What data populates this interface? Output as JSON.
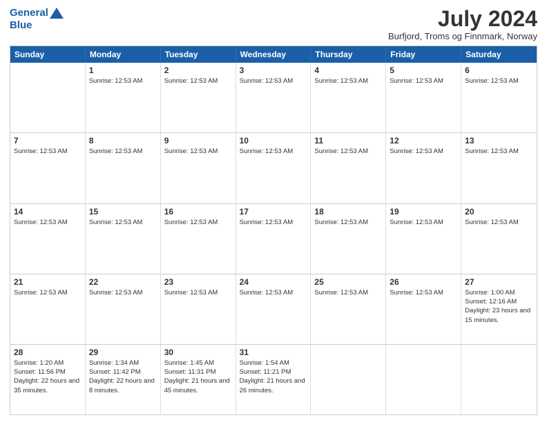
{
  "logo": {
    "line1": "General",
    "line2": "Blue"
  },
  "title": "July 2024",
  "subtitle": "Burfjord, Troms og Finnmark, Norway",
  "header_days": [
    "Sunday",
    "Monday",
    "Tuesday",
    "Wednesday",
    "Thursday",
    "Friday",
    "Saturday"
  ],
  "weeks": [
    [
      {
        "day": "",
        "info": ""
      },
      {
        "day": "1",
        "info": "Sunrise: 12:53 AM"
      },
      {
        "day": "2",
        "info": "Sunrise: 12:53 AM"
      },
      {
        "day": "3",
        "info": "Sunrise: 12:53 AM"
      },
      {
        "day": "4",
        "info": "Sunrise: 12:53 AM"
      },
      {
        "day": "5",
        "info": "Sunrise: 12:53 AM"
      },
      {
        "day": "6",
        "info": "Sunrise: 12:53 AM"
      }
    ],
    [
      {
        "day": "7",
        "info": "Sunrise: 12:53 AM"
      },
      {
        "day": "8",
        "info": "Sunrise: 12:53 AM"
      },
      {
        "day": "9",
        "info": "Sunrise: 12:53 AM"
      },
      {
        "day": "10",
        "info": "Sunrise: 12:53 AM"
      },
      {
        "day": "11",
        "info": "Sunrise: 12:53 AM"
      },
      {
        "day": "12",
        "info": "Sunrise: 12:53 AM"
      },
      {
        "day": "13",
        "info": "Sunrise: 12:53 AM"
      }
    ],
    [
      {
        "day": "14",
        "info": "Sunrise: 12:53 AM"
      },
      {
        "day": "15",
        "info": "Sunrise: 12:53 AM"
      },
      {
        "day": "16",
        "info": "Sunrise: 12:53 AM"
      },
      {
        "day": "17",
        "info": "Sunrise: 12:53 AM"
      },
      {
        "day": "18",
        "info": "Sunrise: 12:53 AM"
      },
      {
        "day": "19",
        "info": "Sunrise: 12:53 AM"
      },
      {
        "day": "20",
        "info": "Sunrise: 12:53 AM"
      }
    ],
    [
      {
        "day": "21",
        "info": "Sunrise: 12:53 AM"
      },
      {
        "day": "22",
        "info": "Sunrise: 12:53 AM"
      },
      {
        "day": "23",
        "info": "Sunrise: 12:53 AM"
      },
      {
        "day": "24",
        "info": "Sunrise: 12:53 AM"
      },
      {
        "day": "25",
        "info": "Sunrise: 12:53 AM"
      },
      {
        "day": "26",
        "info": "Sunrise: 12:53 AM"
      },
      {
        "day": "27",
        "info": "Sunrise: 1:00 AM\nSunset: 12:16 AM\nDaylight: 23 hours and 15 minutes."
      }
    ],
    [
      {
        "day": "28",
        "info": "Sunrise: 1:20 AM\nSunset: 11:56 PM\nDaylight: 22 hours and 35 minutes."
      },
      {
        "day": "29",
        "info": "Sunrise: 1:34 AM\nSunset: 11:42 PM\nDaylight: 22 hours and 8 minutes."
      },
      {
        "day": "30",
        "info": "Sunrise: 1:45 AM\nSunset: 11:31 PM\nDaylight: 21 hours and 45 minutes."
      },
      {
        "day": "31",
        "info": "Sunrise: 1:54 AM\nSunset: 11:21 PM\nDaylight: 21 hours and 26 minutes."
      },
      {
        "day": "",
        "info": ""
      },
      {
        "day": "",
        "info": ""
      },
      {
        "day": "",
        "info": ""
      }
    ]
  ]
}
